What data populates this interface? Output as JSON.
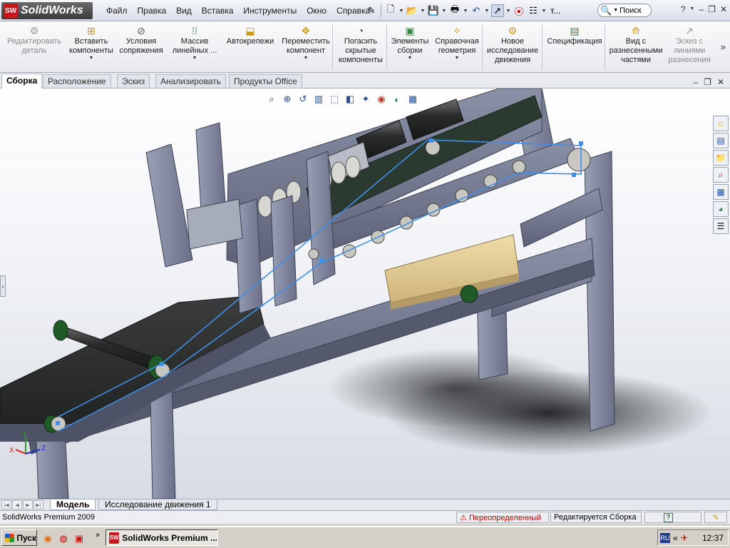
{
  "app": {
    "brand": "SolidWorks",
    "logo_mark": "SW"
  },
  "menu": [
    "Файл",
    "Правка",
    "Вид",
    "Вставка",
    "Инструменты",
    "Окно",
    "Справка"
  ],
  "toolbar": {
    "truncated_label": "т...",
    "search_placeholder": "Поиск",
    "help_glyph": "?"
  },
  "commands": [
    {
      "label": "Редактировать\nдеталь",
      "icon": "edit-part-icon",
      "disabled": true
    },
    {
      "label": "Вставить\nкомпоненты",
      "icon": "insert-components-icon",
      "dropdown": true
    },
    {
      "label": "Условия\nсопряжения",
      "icon": "mate-icon"
    },
    {
      "label": "Массив\nлинейных ...",
      "icon": "linear-pattern-icon",
      "dropdown": true
    },
    {
      "label": "Автокрепежи",
      "icon": "smart-fasteners-icon"
    },
    {
      "label": "Переместить\nкомпонент",
      "icon": "move-component-icon",
      "dropdown": true
    },
    {
      "label": "Погасить\nскрытые\nкомпоненты",
      "icon": "hide-components-icon"
    },
    {
      "label": "Элементы\nсборки",
      "icon": "assembly-features-icon",
      "dropdown": true
    },
    {
      "label": "Справочная\nгеометрия",
      "icon": "reference-geometry-icon",
      "dropdown": true
    },
    {
      "label": "Новое\nисследование\nдвижения",
      "icon": "motion-study-icon"
    },
    {
      "label": "Спецификация",
      "icon": "bom-icon"
    },
    {
      "label": "Вид с\nразнесенными\nчастями",
      "icon": "exploded-view-icon"
    },
    {
      "label": "Эскиз с\nлиниями\nразнесения",
      "icon": "explode-line-sketch-icon",
      "disabled": true
    }
  ],
  "tabs": [
    "Сборка",
    "Расположение",
    "Эскиз",
    "Анализировать",
    "Продукты Office"
  ],
  "active_tab": "Сборка",
  "triad": {
    "x": "X",
    "y": "Y",
    "z": "Z"
  },
  "model_tabs": [
    "Модель",
    "Исследование движения 1"
  ],
  "status": {
    "product": "SolidWorks Premium 2009",
    "state": "Переопределенный",
    "mode": "Редактируется Сборка",
    "help": "?"
  },
  "taskbar": {
    "start": "Пуск",
    "more": "»",
    "task": "SolidWorks Premium ...",
    "lang": "RU",
    "clock": "12:37"
  }
}
